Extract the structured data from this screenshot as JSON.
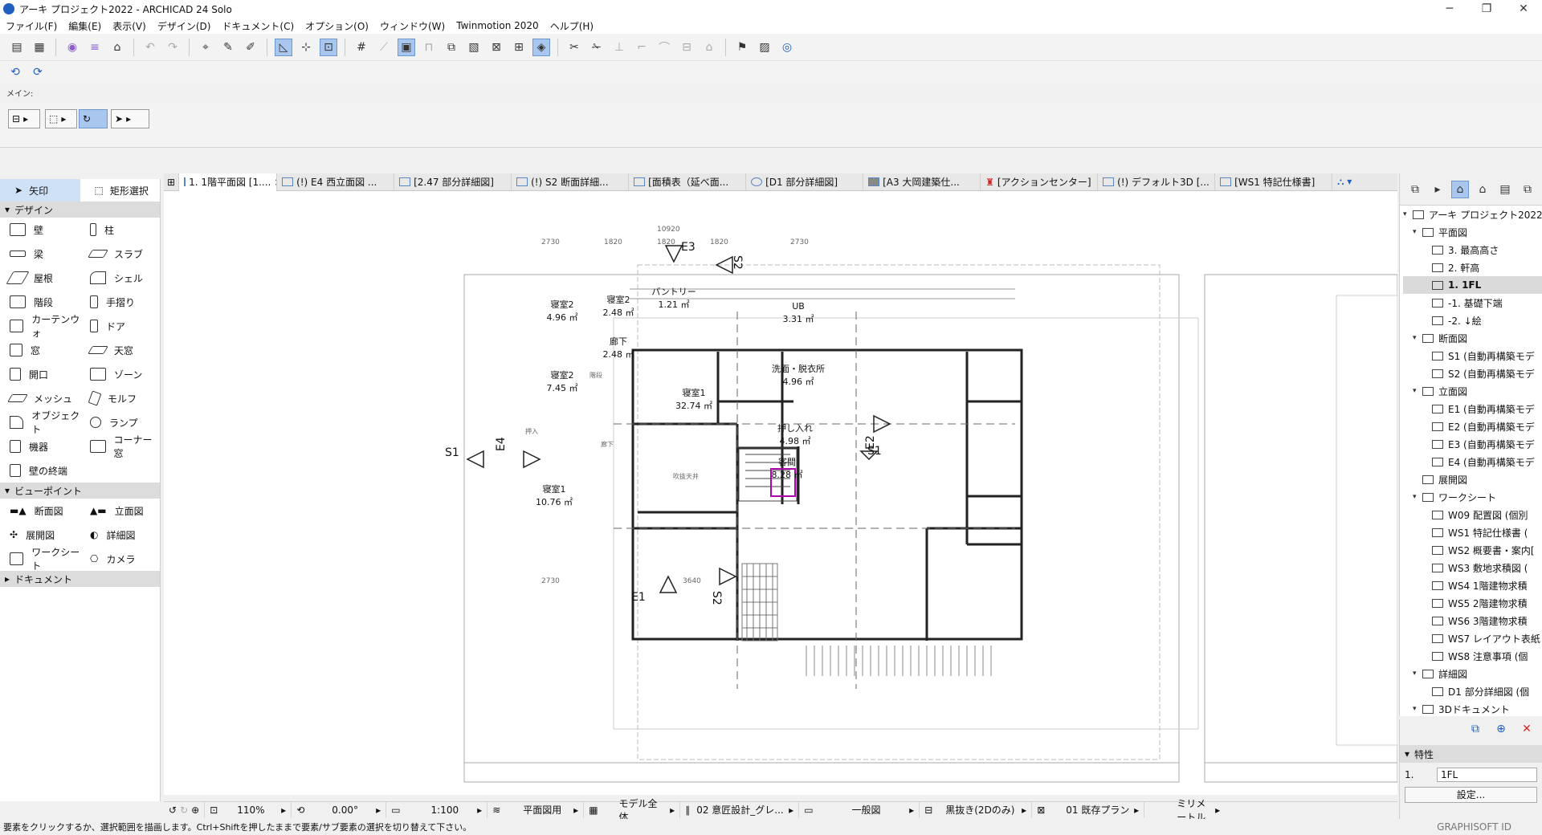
{
  "window": {
    "title": "アーキ プロジェクト2022 - ARCHICAD 24 Solo",
    "min": "─",
    "max": "❐",
    "close": "✕"
  },
  "menu": [
    "ファイル(F)",
    "編集(E)",
    "表示(V)",
    "デザイン(D)",
    "ドキュメント(C)",
    "オプション(O)",
    "ウィンドウ(W)",
    "Twinmotion 2020",
    "ヘルプ(H)"
  ],
  "main_label": "メイン:",
  "toolbox": {
    "arrow": "矢印",
    "marquee": "矩形選択",
    "sections": {
      "design": "デザイン",
      "viewpoint": "ビューポイント",
      "document": "ドキュメント"
    },
    "design_tools": [
      "壁",
      "柱",
      "梁",
      "スラブ",
      "屋根",
      "シェル",
      "階段",
      "手摺り",
      "カーテンウォ",
      "ドア",
      "窓",
      "天窓",
      "開口",
      "ゾーン",
      "メッシュ",
      "モルフ",
      "オブジェクト",
      "ランプ",
      "機器",
      "コーナー窓",
      "壁の終端"
    ],
    "viewpoint_tools": [
      "断面図",
      "立面図",
      "展開図",
      "詳細図",
      "ワークシート",
      "カメラ"
    ]
  },
  "tabs": [
    {
      "label": "1. 1階平面図 [1....",
      "active": true
    },
    {
      "label": "(!) E4 西立面図 ..."
    },
    {
      "label": "[2.47 部分詳細図]"
    },
    {
      "label": "(!) S2 断面詳細..."
    },
    {
      "label": "[面積表（延べ面..."
    },
    {
      "label": "[D1 部分詳細図]"
    },
    {
      "label": "[A3 大岡建築仕..."
    },
    {
      "label": "[アクションセンター]"
    },
    {
      "label": "(!) デフォルト3D [..."
    },
    {
      "label": "[WS1 特記仕様書]"
    }
  ],
  "tab_close": "×",
  "plan": {
    "rooms": [
      {
        "name": "寝室2",
        "area": "4.96 ㎡"
      },
      {
        "name": "寝室2",
        "area": "2.48 ㎡"
      },
      {
        "name": "パントリー",
        "area": "1.21 ㎡"
      },
      {
        "name": "UB",
        "area": "3.31 ㎡"
      },
      {
        "name": "廊下",
        "area": "2.48 ㎡"
      },
      {
        "name": "寝室2",
        "area": "7.45 ㎡"
      },
      {
        "name": "寝室1",
        "area": "32.74 ㎡"
      },
      {
        "name": "洗面・脱衣所",
        "area": "4.96 ㎡"
      },
      {
        "name": "押し入れ",
        "area": "4.98 ㎡"
      },
      {
        "name": "客間",
        "area": "8.28 ㎡"
      },
      {
        "name": "寝室1",
        "area": "10.76 ㎡"
      }
    ],
    "markers": {
      "e3": "E3",
      "e4": "E4",
      "e2": "E2",
      "e1": "E1",
      "s1_left": "S1",
      "s1_right": "S1",
      "s2_top": "S2",
      "s2_bottom": "S2"
    },
    "dims_top": [
      "2730",
      "1820",
      "1820",
      "1820",
      "2730"
    ],
    "dim_total": "10920",
    "dims_bottom": [
      "2730",
      "3640"
    ],
    "small_labels": {
      "stair": "階段",
      "corridor": "廊下",
      "closet": "押入",
      "void": "吹抜",
      "ceiling": "吹抜天井"
    }
  },
  "quick_options": {
    "zoom": "110%",
    "angle": "0.00°",
    "scale": "1:100",
    "layer": "平面図用",
    "model_view": "モデル全体",
    "pen_set": "02 意匠設計_グレ...",
    "override": "一般図",
    "fill": "黒抜き(2Dのみ)",
    "renovation": "01 既存プラン",
    "dimension": "ミリメートル"
  },
  "status_message": "要素をクリックするか、選択範囲を描画します。Ctrl+Shiftを押したままで要素/サブ要素の選択を切り替えて下さい。",
  "graphisoft_id": "GRAPHISOFT ID",
  "navigator": {
    "root": "アーキ プロジェクト2022",
    "items": [
      {
        "label": "平面図",
        "level": 1,
        "folder": true
      },
      {
        "label": "3. 最高高さ",
        "level": 2
      },
      {
        "label": "2. 軒高",
        "level": 2
      },
      {
        "label": "1. 1FL",
        "level": 2,
        "selected": true
      },
      {
        "label": "-1. 基礎下端",
        "level": 2
      },
      {
        "label": "-2. ↓絵",
        "level": 2
      },
      {
        "label": "断面図",
        "level": 1,
        "folder": true
      },
      {
        "label": "S1 (自動再構築モデ",
        "level": 2
      },
      {
        "label": "S2 (自動再構築モデ",
        "level": 2
      },
      {
        "label": "立面図",
        "level": 1,
        "folder": true
      },
      {
        "label": "E1 (自動再構築モデ",
        "level": 2
      },
      {
        "label": "E2 (自動再構築モデ",
        "level": 2
      },
      {
        "label": "E3 (自動再構築モデ",
        "level": 2
      },
      {
        "label": "E4 (自動再構築モデ",
        "level": 2
      },
      {
        "label": "展開図",
        "level": 1
      },
      {
        "label": "ワークシート",
        "level": 1,
        "folder": true
      },
      {
        "label": "W09 配置図 (個別",
        "level": 2
      },
      {
        "label": "WS1 特記仕様書 (",
        "level": 2
      },
      {
        "label": "WS2 概要書・案内[",
        "level": 2
      },
      {
        "label": "WS3 敷地求積図 (",
        "level": 2
      },
      {
        "label": "WS4 1階建物求積",
        "level": 2
      },
      {
        "label": "WS5 2階建物求積",
        "level": 2
      },
      {
        "label": "WS6 3階建物求積",
        "level": 2
      },
      {
        "label": "WS7 レイアウト表紙",
        "level": 2
      },
      {
        "label": "WS8 注意事項 (個",
        "level": 2
      },
      {
        "label": "詳細図",
        "level": 1,
        "folder": true
      },
      {
        "label": "D1 部分詳細図 (個",
        "level": 2
      },
      {
        "label": "3Dドキュメント",
        "level": 1,
        "folder": true
      }
    ],
    "properties_title": "特性",
    "prop_id": "1.",
    "prop_name": "1FL",
    "settings_button": "設定..."
  }
}
